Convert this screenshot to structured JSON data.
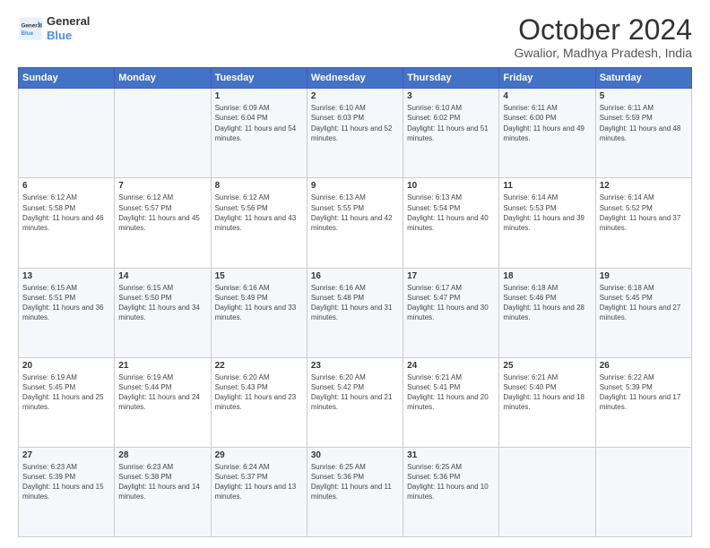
{
  "logo": {
    "line1": "General",
    "line2": "Blue"
  },
  "header": {
    "title": "October 2024",
    "location": "Gwalior, Madhya Pradesh, India"
  },
  "columns": [
    "Sunday",
    "Monday",
    "Tuesday",
    "Wednesday",
    "Thursday",
    "Friday",
    "Saturday"
  ],
  "weeks": [
    [
      {
        "day": "",
        "sunrise": "",
        "sunset": "",
        "daylight": ""
      },
      {
        "day": "",
        "sunrise": "",
        "sunset": "",
        "daylight": ""
      },
      {
        "day": "1",
        "sunrise": "Sunrise: 6:09 AM",
        "sunset": "Sunset: 6:04 PM",
        "daylight": "Daylight: 11 hours and 54 minutes."
      },
      {
        "day": "2",
        "sunrise": "Sunrise: 6:10 AM",
        "sunset": "Sunset: 6:03 PM",
        "daylight": "Daylight: 11 hours and 52 minutes."
      },
      {
        "day": "3",
        "sunrise": "Sunrise: 6:10 AM",
        "sunset": "Sunset: 6:02 PM",
        "daylight": "Daylight: 11 hours and 51 minutes."
      },
      {
        "day": "4",
        "sunrise": "Sunrise: 6:11 AM",
        "sunset": "Sunset: 6:00 PM",
        "daylight": "Daylight: 11 hours and 49 minutes."
      },
      {
        "day": "5",
        "sunrise": "Sunrise: 6:11 AM",
        "sunset": "Sunset: 5:59 PM",
        "daylight": "Daylight: 11 hours and 48 minutes."
      }
    ],
    [
      {
        "day": "6",
        "sunrise": "Sunrise: 6:12 AM",
        "sunset": "Sunset: 5:58 PM",
        "daylight": "Daylight: 11 hours and 46 minutes."
      },
      {
        "day": "7",
        "sunrise": "Sunrise: 6:12 AM",
        "sunset": "Sunset: 5:57 PM",
        "daylight": "Daylight: 11 hours and 45 minutes."
      },
      {
        "day": "8",
        "sunrise": "Sunrise: 6:12 AM",
        "sunset": "Sunset: 5:56 PM",
        "daylight": "Daylight: 11 hours and 43 minutes."
      },
      {
        "day": "9",
        "sunrise": "Sunrise: 6:13 AM",
        "sunset": "Sunset: 5:55 PM",
        "daylight": "Daylight: 11 hours and 42 minutes."
      },
      {
        "day": "10",
        "sunrise": "Sunrise: 6:13 AM",
        "sunset": "Sunset: 5:54 PM",
        "daylight": "Daylight: 11 hours and 40 minutes."
      },
      {
        "day": "11",
        "sunrise": "Sunrise: 6:14 AM",
        "sunset": "Sunset: 5:53 PM",
        "daylight": "Daylight: 11 hours and 39 minutes."
      },
      {
        "day": "12",
        "sunrise": "Sunrise: 6:14 AM",
        "sunset": "Sunset: 5:52 PM",
        "daylight": "Daylight: 11 hours and 37 minutes."
      }
    ],
    [
      {
        "day": "13",
        "sunrise": "Sunrise: 6:15 AM",
        "sunset": "Sunset: 5:51 PM",
        "daylight": "Daylight: 11 hours and 36 minutes."
      },
      {
        "day": "14",
        "sunrise": "Sunrise: 6:15 AM",
        "sunset": "Sunset: 5:50 PM",
        "daylight": "Daylight: 11 hours and 34 minutes."
      },
      {
        "day": "15",
        "sunrise": "Sunrise: 6:16 AM",
        "sunset": "Sunset: 5:49 PM",
        "daylight": "Daylight: 11 hours and 33 minutes."
      },
      {
        "day": "16",
        "sunrise": "Sunrise: 6:16 AM",
        "sunset": "Sunset: 5:48 PM",
        "daylight": "Daylight: 11 hours and 31 minutes."
      },
      {
        "day": "17",
        "sunrise": "Sunrise: 6:17 AM",
        "sunset": "Sunset: 5:47 PM",
        "daylight": "Daylight: 11 hours and 30 minutes."
      },
      {
        "day": "18",
        "sunrise": "Sunrise: 6:18 AM",
        "sunset": "Sunset: 5:46 PM",
        "daylight": "Daylight: 11 hours and 28 minutes."
      },
      {
        "day": "19",
        "sunrise": "Sunrise: 6:18 AM",
        "sunset": "Sunset: 5:45 PM",
        "daylight": "Daylight: 11 hours and 27 minutes."
      }
    ],
    [
      {
        "day": "20",
        "sunrise": "Sunrise: 6:19 AM",
        "sunset": "Sunset: 5:45 PM",
        "daylight": "Daylight: 11 hours and 25 minutes."
      },
      {
        "day": "21",
        "sunrise": "Sunrise: 6:19 AM",
        "sunset": "Sunset: 5:44 PM",
        "daylight": "Daylight: 11 hours and 24 minutes."
      },
      {
        "day": "22",
        "sunrise": "Sunrise: 6:20 AM",
        "sunset": "Sunset: 5:43 PM",
        "daylight": "Daylight: 11 hours and 23 minutes."
      },
      {
        "day": "23",
        "sunrise": "Sunrise: 6:20 AM",
        "sunset": "Sunset: 5:42 PM",
        "daylight": "Daylight: 11 hours and 21 minutes."
      },
      {
        "day": "24",
        "sunrise": "Sunrise: 6:21 AM",
        "sunset": "Sunset: 5:41 PM",
        "daylight": "Daylight: 11 hours and 20 minutes."
      },
      {
        "day": "25",
        "sunrise": "Sunrise: 6:21 AM",
        "sunset": "Sunset: 5:40 PM",
        "daylight": "Daylight: 11 hours and 18 minutes."
      },
      {
        "day": "26",
        "sunrise": "Sunrise: 6:22 AM",
        "sunset": "Sunset: 5:39 PM",
        "daylight": "Daylight: 11 hours and 17 minutes."
      }
    ],
    [
      {
        "day": "27",
        "sunrise": "Sunrise: 6:23 AM",
        "sunset": "Sunset: 5:39 PM",
        "daylight": "Daylight: 11 hours and 15 minutes."
      },
      {
        "day": "28",
        "sunrise": "Sunrise: 6:23 AM",
        "sunset": "Sunset: 5:38 PM",
        "daylight": "Daylight: 11 hours and 14 minutes."
      },
      {
        "day": "29",
        "sunrise": "Sunrise: 6:24 AM",
        "sunset": "Sunset: 5:37 PM",
        "daylight": "Daylight: 11 hours and 13 minutes."
      },
      {
        "day": "30",
        "sunrise": "Sunrise: 6:25 AM",
        "sunset": "Sunset: 5:36 PM",
        "daylight": "Daylight: 11 hours and 11 minutes."
      },
      {
        "day": "31",
        "sunrise": "Sunrise: 6:25 AM",
        "sunset": "Sunset: 5:36 PM",
        "daylight": "Daylight: 11 hours and 10 minutes."
      },
      {
        "day": "",
        "sunrise": "",
        "sunset": "",
        "daylight": ""
      },
      {
        "day": "",
        "sunrise": "",
        "sunset": "",
        "daylight": ""
      }
    ]
  ]
}
